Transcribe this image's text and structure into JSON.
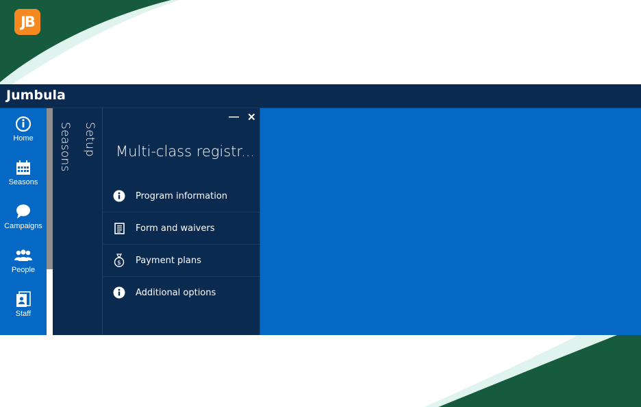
{
  "app": {
    "title": "Jumbula",
    "logo_text": "JB"
  },
  "colors": {
    "topbar": "#0b2a4f",
    "accent": "#0468c4",
    "logo": "#f5891f",
    "swoosh_dark": "#165b3e",
    "swoosh_light": "#dff4ee"
  },
  "leftnav": {
    "items": [
      {
        "label": "Home",
        "icon": "home-icon"
      },
      {
        "label": "Seasons",
        "icon": "calendar-icon"
      },
      {
        "label": "Campaigns",
        "icon": "chat-bubble-icon"
      },
      {
        "label": "People",
        "icon": "people-icon"
      },
      {
        "label": "Staff",
        "icon": "staff-card-icon"
      }
    ]
  },
  "strips": {
    "seasons": "Seasons",
    "setup": "Setup"
  },
  "panel": {
    "title": "Multi-class registr...",
    "minimize_glyph": "—",
    "close_glyph": "✕",
    "menu": [
      {
        "label": "Program information",
        "icon": "info-icon"
      },
      {
        "label": "Form and waivers",
        "icon": "document-icon"
      },
      {
        "label": "Payment plans",
        "icon": "money-bag-icon"
      },
      {
        "label": "Additional options",
        "icon": "info-icon"
      }
    ]
  }
}
